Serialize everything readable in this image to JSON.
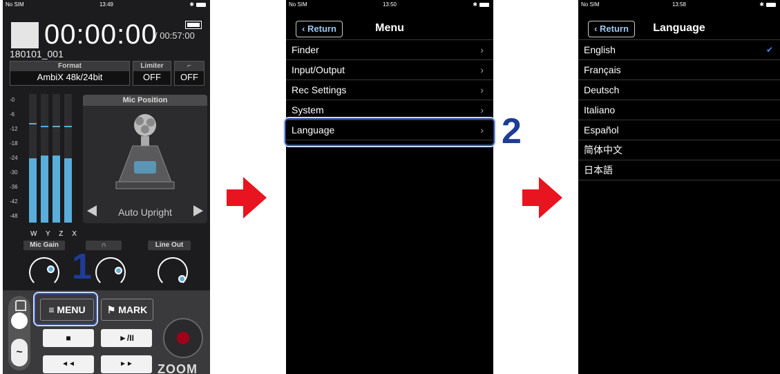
{
  "colors": {
    "arrow": "#e8141f",
    "callout": "#1e3c96",
    "meter": "#5aaedc",
    "check": "#3b8ef0"
  },
  "phone1": {
    "status": {
      "carrier": "No SIM",
      "time": "13:49"
    },
    "timer": "00:00:00",
    "remaining": "/ 00:57:00",
    "filename": "180101_001",
    "format": {
      "label": "Format",
      "value": "AmbiX   48k/24bit"
    },
    "limiter": {
      "label": "Limiter",
      "value": "OFF"
    },
    "filter": {
      "value": "OFF"
    },
    "meter_scale": [
      "-0",
      "-6",
      "-12",
      "-18",
      "-24",
      "-30",
      "-36",
      "-42",
      "-48"
    ],
    "channels": "W Y Z X",
    "meter_levels": [
      0.5,
      0.52,
      0.52,
      0.5
    ],
    "mic_position": {
      "title": "Mic Position",
      "mode": "Auto Upright"
    },
    "knobs": {
      "mic_gain": "Mic Gain",
      "line_out": "Line Out"
    },
    "buttons": {
      "menu": "MENU",
      "mark": "MARK",
      "stop": "■",
      "play_pause": "►/II",
      "rew": "◄◄",
      "ff": "►►"
    },
    "logo": "ZOOM",
    "step": "1"
  },
  "phone2": {
    "status": {
      "carrier": "No SIM",
      "time": "13:50"
    },
    "back": "Return",
    "title": "Menu",
    "items": [
      "Finder",
      "Input/Output",
      "Rec Settings",
      "System",
      "Language"
    ],
    "step": "2"
  },
  "phone3": {
    "status": {
      "carrier": "No SIM",
      "time": "13:58"
    },
    "back": "Return",
    "title": "Language",
    "items": [
      "English",
      "Français",
      "Deutsch",
      "Italiano",
      "Español",
      "简体中文",
      "日本語"
    ],
    "selected": "English"
  }
}
